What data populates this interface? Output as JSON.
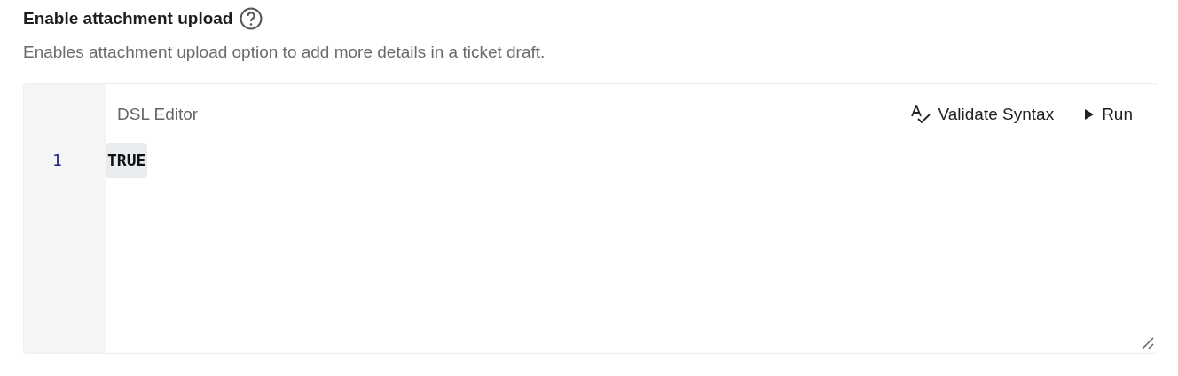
{
  "setting": {
    "title": "Enable attachment upload",
    "description": "Enables attachment upload option to add more details in a ticket draft."
  },
  "editor": {
    "title": "DSL Editor",
    "actions": [
      {
        "kind": "validate",
        "label": "Validate Syntax"
      },
      {
        "kind": "run",
        "label": "Run"
      }
    ],
    "lines": [
      {
        "number": "1",
        "code": "TRUE",
        "selected": true
      }
    ]
  }
}
